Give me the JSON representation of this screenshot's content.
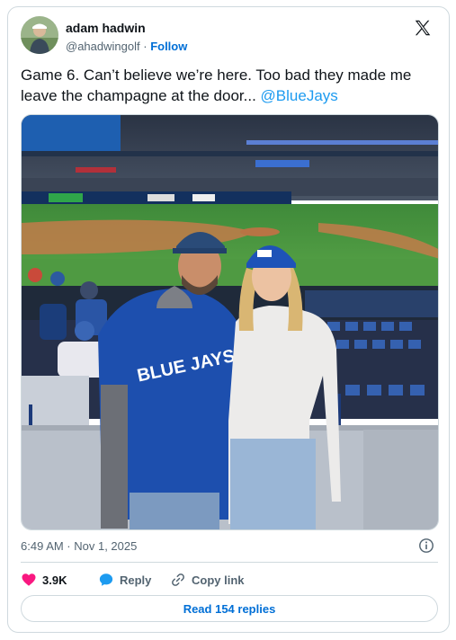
{
  "author": {
    "display_name": "adam hadwin",
    "handle": "@ahadwingolf",
    "separator": "·",
    "follow_label": "Follow"
  },
  "tweet": {
    "text": "Game 6. Can’t believe we’re here. Too bad they made me leave the champagne at the door...",
    "mention": "@BlueJays"
  },
  "photo": {
    "jersey_text": "BLUE JAYS"
  },
  "meta": {
    "timestamp": "6:49 AM · Nov 1, 2025"
  },
  "actions": {
    "like_count": "3.9K",
    "reply_label": "Reply",
    "copy_link_label": "Copy link"
  },
  "read_replies_label": "Read 154 replies",
  "colors": {
    "link": "#1d9bf0",
    "follow": "#006fd6",
    "like": "#f91880",
    "reply": "#1d9bf0",
    "border": "#cfd9de"
  }
}
